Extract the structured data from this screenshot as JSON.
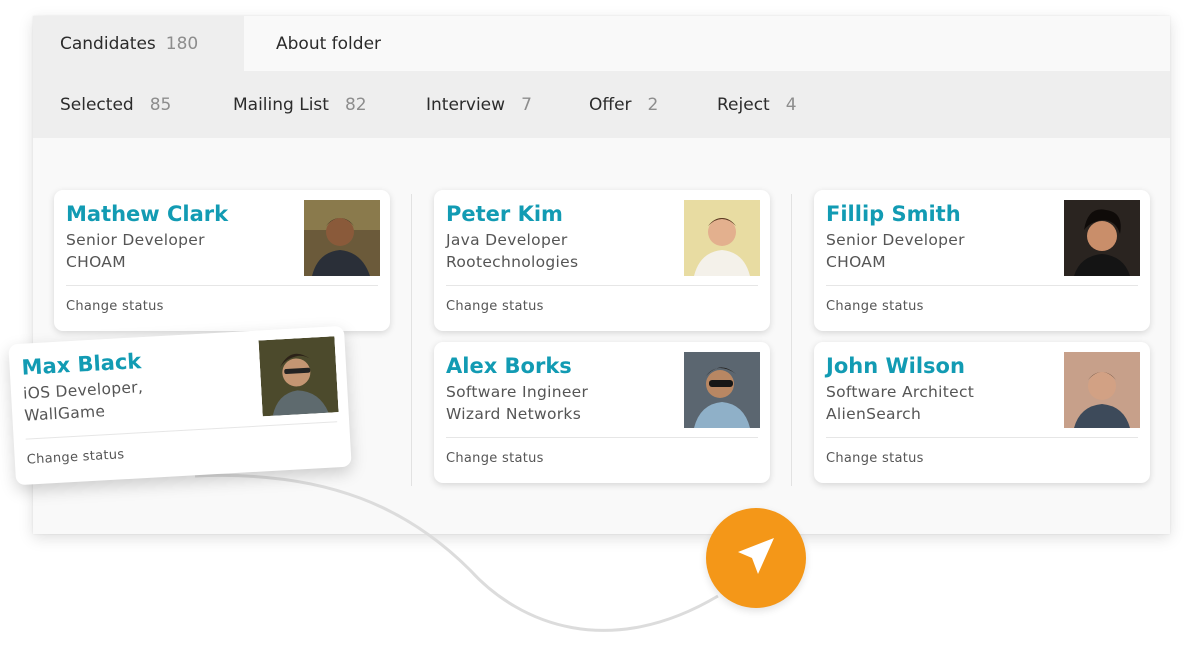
{
  "tabs": [
    {
      "label": "Candidates",
      "count": "180"
    },
    {
      "label": "About folder"
    }
  ],
  "statuses": [
    {
      "label": "Selected",
      "count": "85"
    },
    {
      "label": "Mailing List",
      "count": "82"
    },
    {
      "label": "Interview",
      "count": "7"
    },
    {
      "label": "Offer",
      "count": "2"
    },
    {
      "label": "Reject",
      "count": "4"
    }
  ],
  "cards": [
    {
      "name": "Mathew Clark",
      "role": "Senior Developer",
      "company": "CHOAM",
      "action": "Change status"
    },
    {
      "name": "Peter Kim",
      "role": "Java Developer",
      "company": "Rootechnologies",
      "action": "Change status"
    },
    {
      "name": "Fillip Smith",
      "role": "Senior Developer",
      "company": "CHOAM",
      "action": "Change status"
    },
    {
      "name": "Alex Borks",
      "role": "Software Ingineer",
      "company": "Wizard Networks",
      "action": "Change status"
    },
    {
      "name": "John Wilson",
      "role": "Software Architect",
      "company": "AlienSearch",
      "action": "Change status"
    },
    {
      "name": "Max Black",
      "role": "iOS Developer,",
      "company": "WallGame",
      "action": "Change status"
    }
  ],
  "icons": {
    "fab": "send-arrow-icon",
    "avatar": "avatar-photo"
  },
  "colors": {
    "accent": "#129bb3",
    "fab": "#f49718",
    "tab_active_bg": "#eeeeee"
  }
}
